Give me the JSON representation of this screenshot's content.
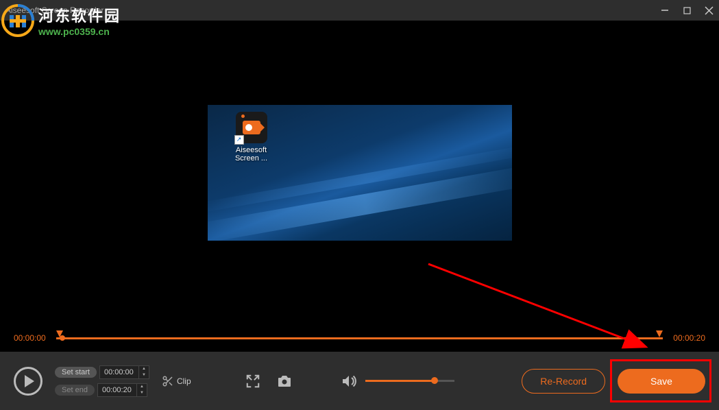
{
  "titlebar": {
    "title": "Aiseesoft Screen Recorder"
  },
  "watermark": {
    "cn": "河东软件园",
    "url": "www.pc0359.cn"
  },
  "preview": {
    "desktop_icon_label": "Aiseesoft Screen ..."
  },
  "timeline": {
    "start": "00:00:00",
    "end": "00:00:20"
  },
  "editors": {
    "set_start_label": "Set start",
    "set_end_label": "Set end",
    "start_value": "00:00:00",
    "end_value": "00:00:20",
    "clip_label": "Clip"
  },
  "volume": {
    "level_percent": 75
  },
  "actions": {
    "rerecord": "Re-Record",
    "save": "Save"
  },
  "colors": {
    "accent": "#ed6b1e",
    "annotation": "#ff0000"
  }
}
